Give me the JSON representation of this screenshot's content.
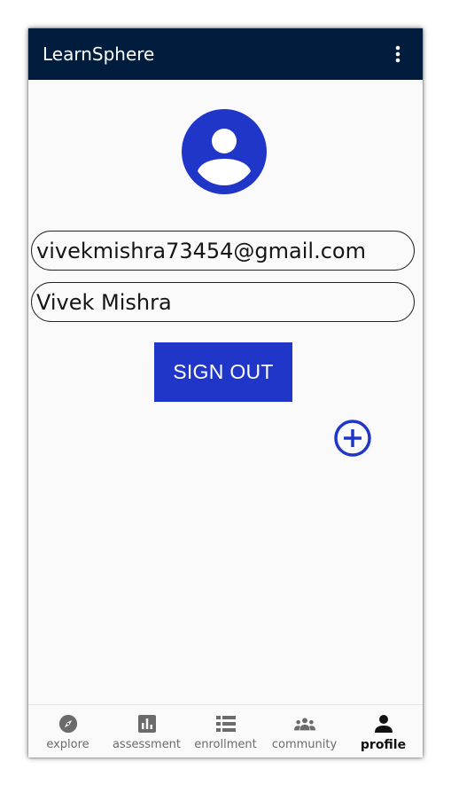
{
  "app": {
    "title": "LearnSphere",
    "menu_icon": "more-vert-icon"
  },
  "profile": {
    "avatar_icon": "account-circle-icon",
    "email": "vivekmishra73454@gmail.com",
    "name": "Vivek Mishra",
    "sign_out_label": "SIGN OUT",
    "add_icon": "add-circle-icon"
  },
  "nav": {
    "items": [
      {
        "label": "explore",
        "icon": "compass-icon"
      },
      {
        "label": "assessment",
        "icon": "bar-chart-icon"
      },
      {
        "label": "enrollment",
        "icon": "list-icon"
      },
      {
        "label": "community",
        "icon": "group-icon"
      },
      {
        "label": "profile",
        "icon": "person-icon"
      }
    ],
    "active": "profile"
  },
  "colors": {
    "appbar": "#001d3d",
    "accent": "#2036c9",
    "background": "#fafafa",
    "nav_inactive": "#6b6b6b",
    "nav_active": "#111111"
  }
}
